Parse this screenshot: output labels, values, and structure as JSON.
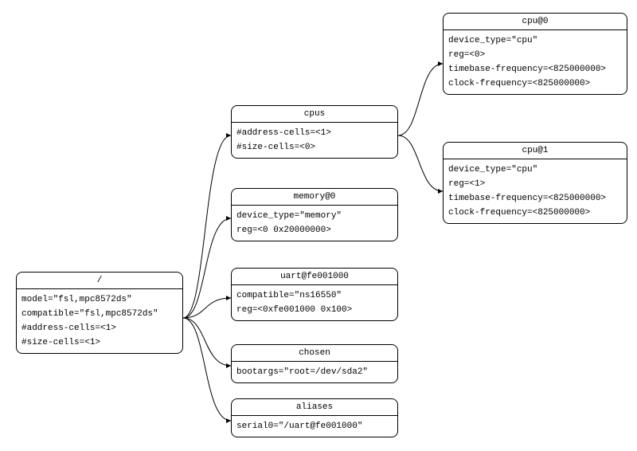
{
  "root": {
    "title": "/",
    "props": {
      "model": "model=\"fsl,mpc8572ds\"",
      "compatible": "compatible=\"fsl,mpc8572ds\"",
      "address_cells": "#address-cells=<1>",
      "size_cells": "#size-cells=<1>"
    }
  },
  "cpus": {
    "title": "cpus",
    "props": {
      "address_cells": "#address-cells=<1>",
      "size_cells": "#size-cells=<0>"
    }
  },
  "memory": {
    "title": "memory@0",
    "props": {
      "device_type": "device_type=\"memory\"",
      "reg": "reg=<0 0x20000000>"
    }
  },
  "uart": {
    "title": "uart@fe001000",
    "props": {
      "compatible": "compatible=\"ns16550\"",
      "reg": "reg=<0xfe001000 0x100>"
    }
  },
  "chosen": {
    "title": "chosen",
    "props": {
      "bootargs": "bootargs=\"root=/dev/sda2\""
    }
  },
  "aliases": {
    "title": "aliases",
    "props": {
      "serial0": "serial0=\"/uart@fe001000\""
    }
  },
  "cpu0": {
    "title": "cpu@0",
    "props": {
      "device_type": "device_type=\"cpu\"",
      "reg": "reg=<0>",
      "timebase": "timebase-frequency=<825000000>",
      "clock": "clock-frequency=<825000000>"
    }
  },
  "cpu1": {
    "title": "cpu@1",
    "props": {
      "device_type": "device_type=\"cpu\"",
      "reg": "reg=<1>",
      "timebase": "timebase-frequency=<825000000>",
      "clock": "clock-frequency=<825000000>"
    }
  }
}
